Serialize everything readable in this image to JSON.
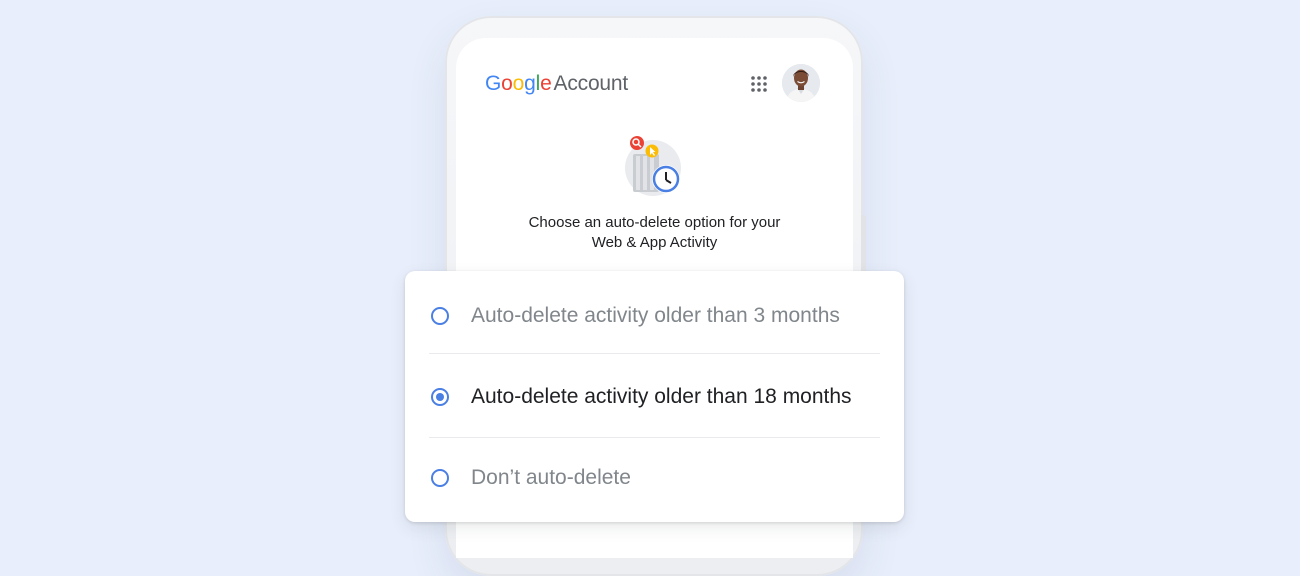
{
  "header": {
    "logo_letters": [
      "G",
      "o",
      "o",
      "g",
      "l",
      "e"
    ],
    "logo_suffix": "Account",
    "apps_icon": "apps-grid-icon",
    "avatar_icon": "profile-avatar"
  },
  "main": {
    "illustration_icon": "auto-delete-activity-illustration",
    "headline_line1": "Choose an auto-delete option for your",
    "headline_line2": "Web & App Activity"
  },
  "options": {
    "items": [
      {
        "label": "Auto-delete activity older than 3 months",
        "selected": false
      },
      {
        "label": "Auto-delete activity older than 18 months",
        "selected": true
      },
      {
        "label": "Don’t auto-delete",
        "selected": false
      }
    ]
  },
  "colors": {
    "background": "#e8eefb",
    "accent": "#4a7fe3",
    "text_selected": "#202124",
    "text_unselected": "#80868b"
  }
}
